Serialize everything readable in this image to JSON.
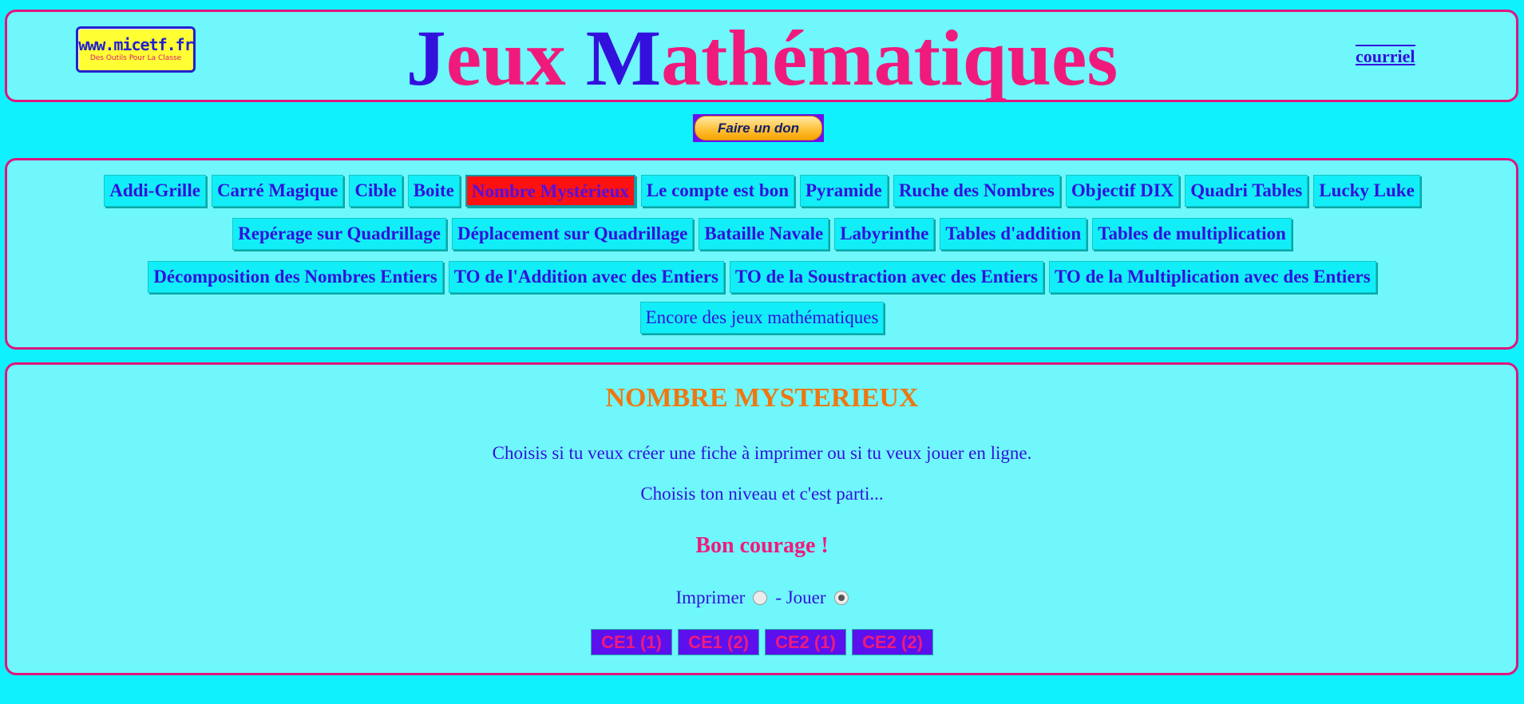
{
  "header": {
    "logo": {
      "main": "www.micetf.fr",
      "sub": "Des Outils Pour La Classe"
    },
    "title_parts": [
      "J",
      "eux ",
      "M",
      "athématiques"
    ],
    "courriel": "courriel"
  },
  "donate": {
    "label": "Faire un don"
  },
  "nav": {
    "row1": [
      "Addi-Grille",
      "Carré Magique",
      "Cible",
      "Boite",
      "Nombre Mystérieux",
      "Le compte est bon",
      "Pyramide",
      "Ruche des Nombres",
      "Objectif DIX",
      "Quadri Tables",
      "Lucky Luke"
    ],
    "row2": [
      "Repérage sur Quadrillage",
      "Déplacement sur Quadrillage",
      "Bataille Navale",
      "Labyrinthe",
      "Tables d'addition",
      "Tables de multiplication"
    ],
    "row3": [
      "Décomposition des Nombres Entiers",
      "TO de l'Addition avec des Entiers",
      "TO de la Soustraction avec des Entiers",
      "TO de la Multiplication avec des Entiers"
    ],
    "row4": [
      "Encore des jeux mathématiques"
    ],
    "active": "Nombre Mystérieux"
  },
  "main": {
    "title": "NOMBRE MYSTERIEUX",
    "line1": "Choisis si tu veux créer une fiche à imprimer ou si tu veux jouer en ligne.",
    "line2": "Choisis ton niveau et c'est parti...",
    "encouragement": "Bon courage !",
    "mode": {
      "imprimer_label": "Imprimer",
      "jouer_label": "- Jouer",
      "selected": "Jouer"
    },
    "levels": [
      "CE1 (1)",
      "CE1 (2)",
      "CE2 (1)",
      "CE2 (2)"
    ]
  },
  "colors": {
    "background": "#0ff2fd",
    "panel": "#6ff7fb",
    "border": "#e0157d",
    "text": "#3311dd",
    "title_pink": "#f01a7c",
    "heading_orange": "#ee7711",
    "active_nav": "#ff1111",
    "level_button": "#5d10ee"
  }
}
